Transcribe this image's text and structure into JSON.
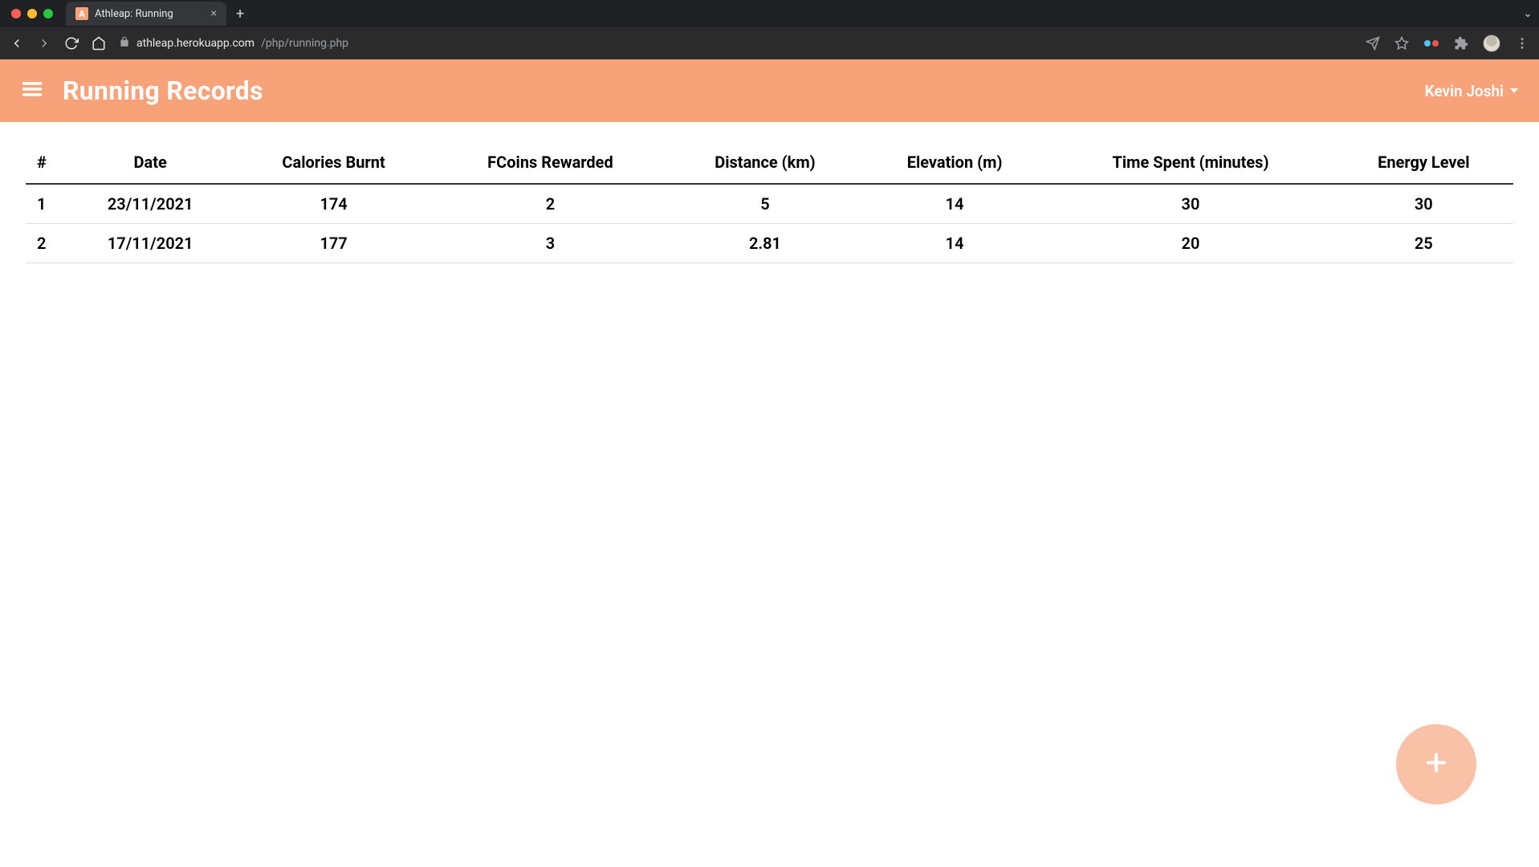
{
  "browser": {
    "tab_title": "Athleap: Running",
    "favicon_letter": "A",
    "url_host": "athleap.herokuapp.com",
    "url_path": "/php/running.php"
  },
  "header": {
    "title": "Running Records",
    "user_name": "Kevin Joshi"
  },
  "table": {
    "columns": [
      "#",
      "Date",
      "Calories Burnt",
      "FCoins Rewarded",
      "Distance (km)",
      "Elevation (m)",
      "Time Spent (minutes)",
      "Energy Level"
    ],
    "rows": [
      {
        "index": "1",
        "date": "23/11/2021",
        "calories": "174",
        "fcoins": "2",
        "distance": "5",
        "elevation": "14",
        "time": "30",
        "energy": "30"
      },
      {
        "index": "2",
        "date": "17/11/2021",
        "calories": "177",
        "fcoins": "3",
        "distance": "2.81",
        "elevation": "14",
        "time": "20",
        "energy": "25"
      }
    ]
  }
}
